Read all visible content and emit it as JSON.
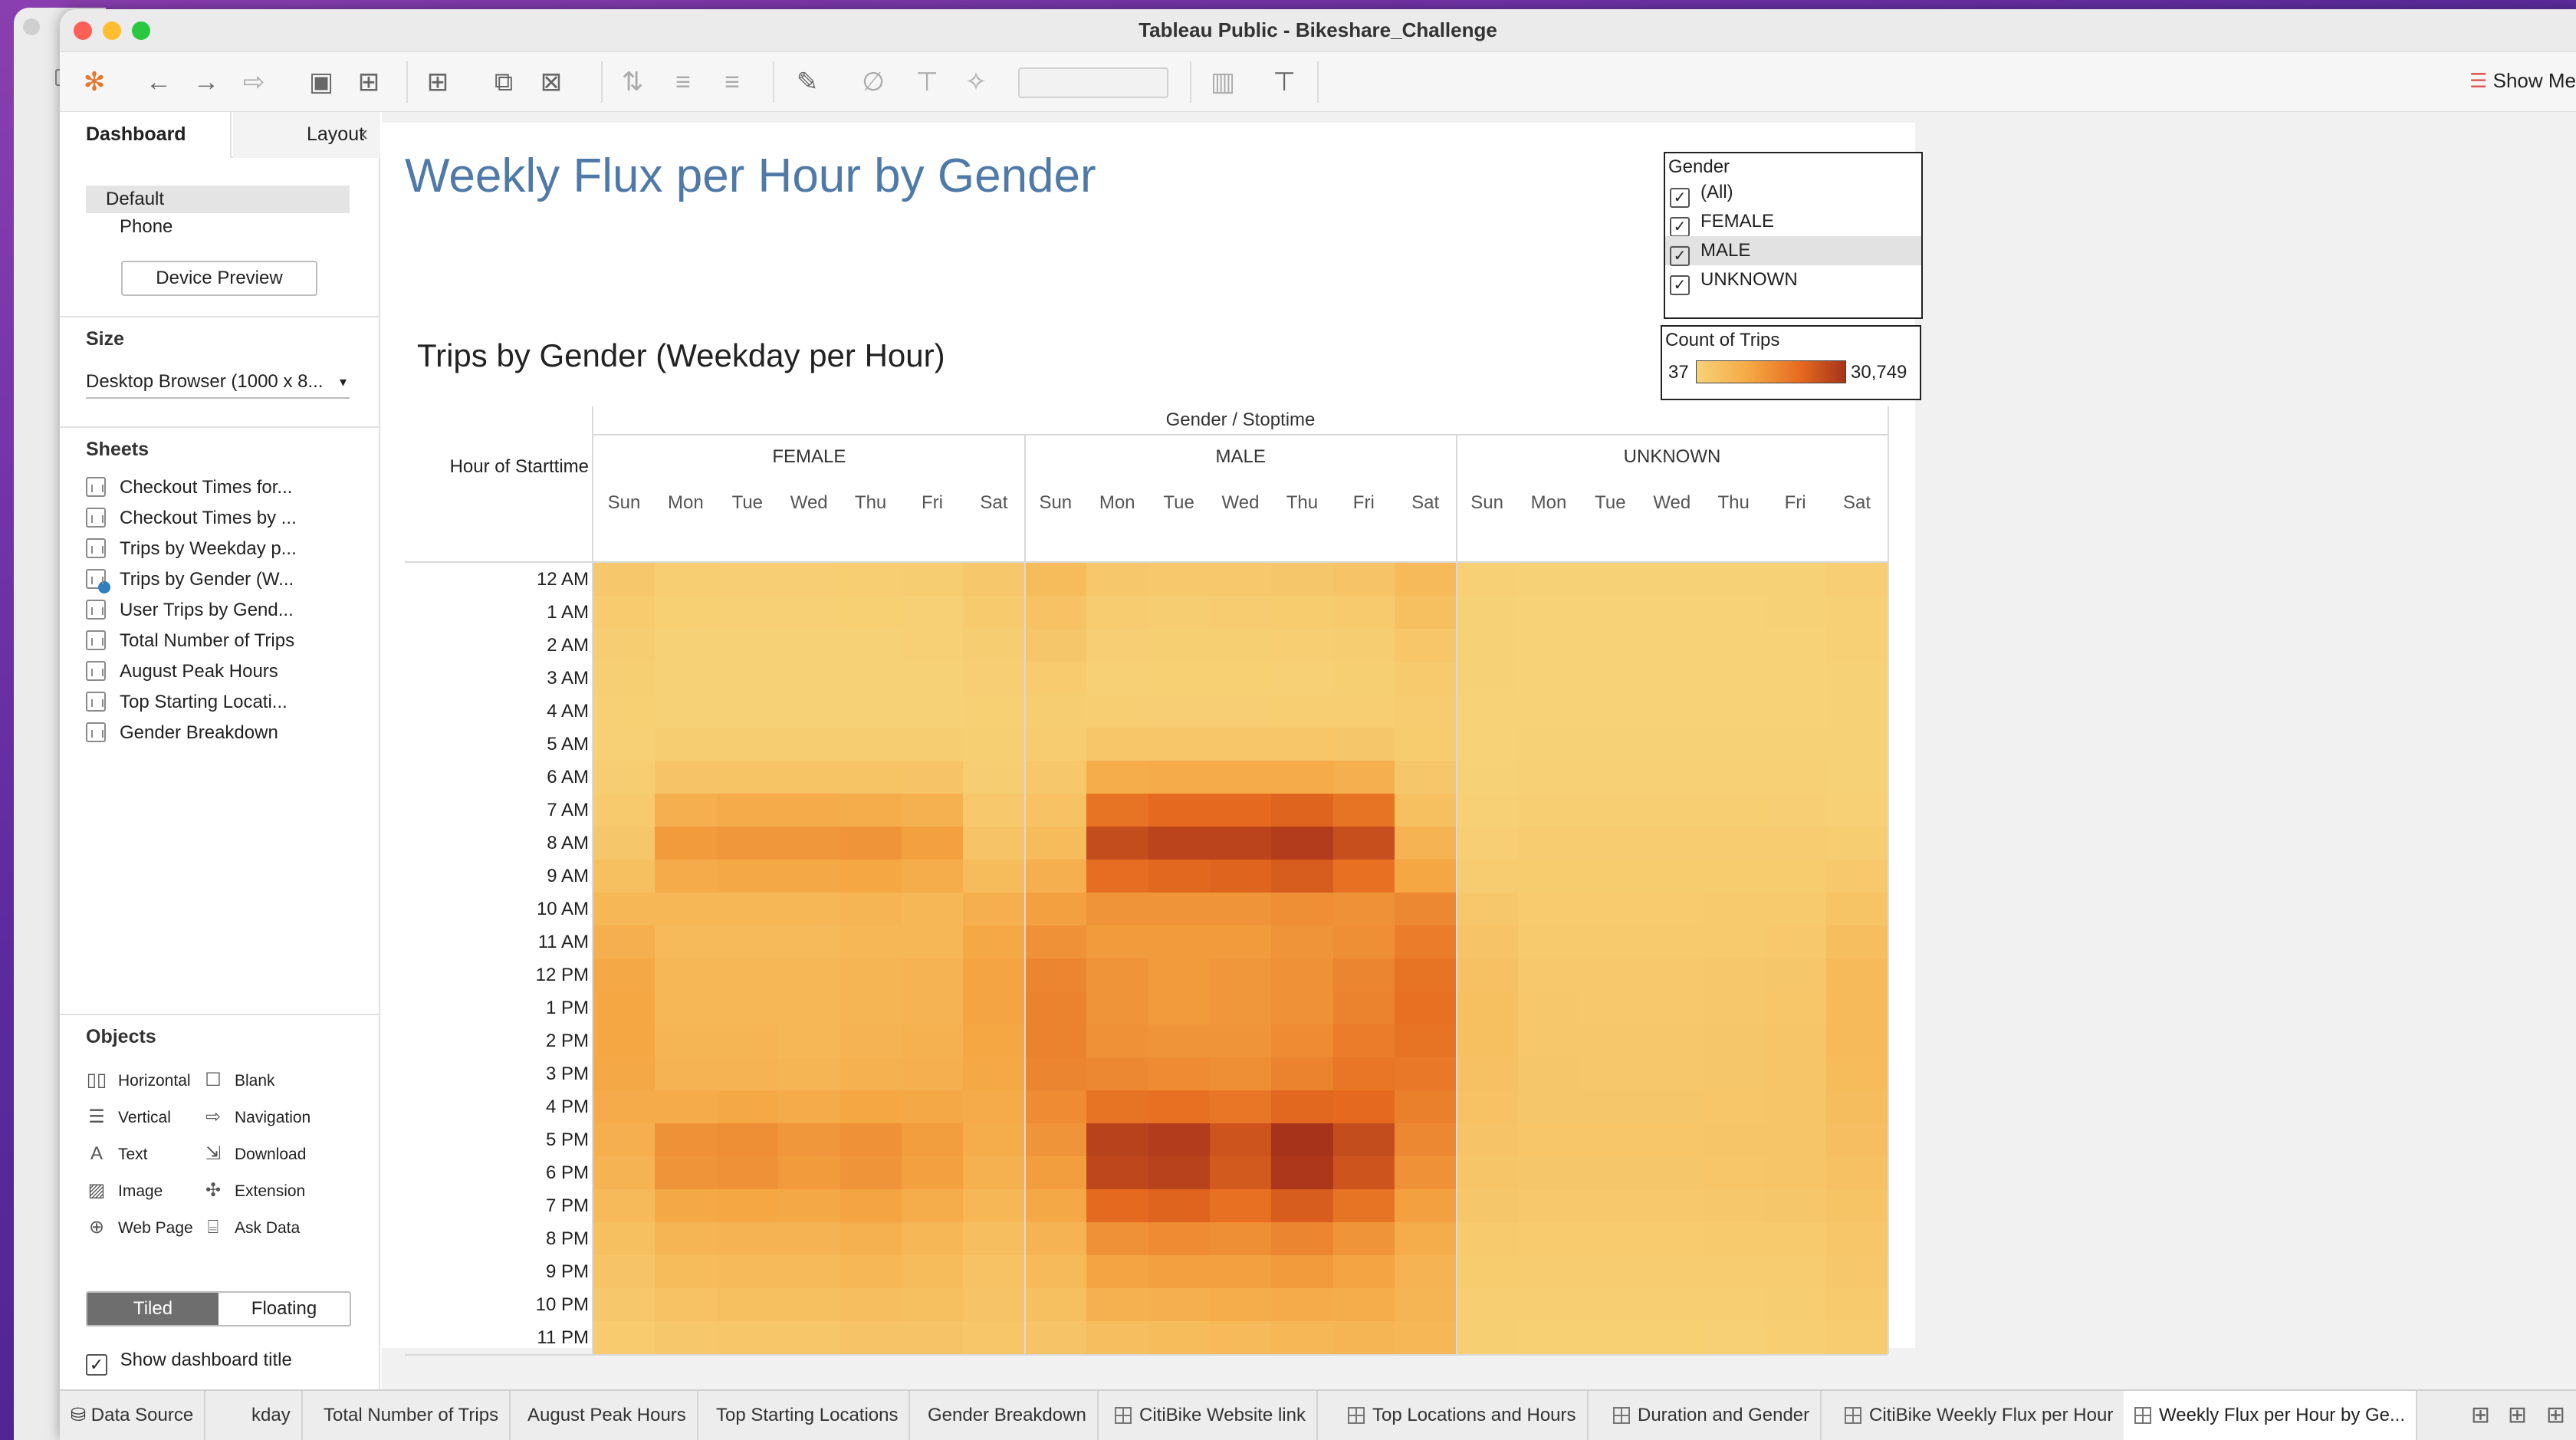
{
  "window": {
    "title": "Tableau Public - Bikeshare_Challenge"
  },
  "toolbar": {
    "show_me": "Show Me"
  },
  "left_pane": {
    "tabs": {
      "dashboard": "Dashboard",
      "layout": "Layout"
    },
    "devices": [
      "Default",
      "Phone"
    ],
    "device_preview": "Device Preview",
    "size_title": "Size",
    "size_value": "Desktop Browser (1000 x 8...",
    "sheets_title": "Sheets",
    "sheets": [
      "Checkout Times for...",
      "Checkout Times by ...",
      "Trips by Weekday p...",
      "Trips by Gender (W...",
      "User Trips by Gend...",
      "Total Number of Trips",
      "August Peak Hours",
      "Top Starting Locati...",
      "Gender Breakdown"
    ],
    "objects_title": "Objects",
    "objects": [
      {
        "label": "Horizontal",
        "icon": "horizontal-icon",
        "glyph": "▯▯"
      },
      {
        "label": "Blank",
        "icon": "blank-icon",
        "glyph": "☐"
      },
      {
        "label": "Vertical",
        "icon": "vertical-icon",
        "glyph": "☰"
      },
      {
        "label": "Navigation",
        "icon": "navigation-icon",
        "glyph": "⇨"
      },
      {
        "label": "Text",
        "icon": "text-icon",
        "glyph": "A"
      },
      {
        "label": "Download",
        "icon": "download-icon",
        "glyph": "⇲"
      },
      {
        "label": "Image",
        "icon": "image-icon",
        "glyph": "▨"
      },
      {
        "label": "Extension",
        "icon": "extension-icon",
        "glyph": "✣"
      },
      {
        "label": "Web Page",
        "icon": "web-page-icon",
        "glyph": "⊕"
      },
      {
        "label": "Ask Data",
        "icon": "ask-data-icon",
        "glyph": "⌸"
      }
    ],
    "tiled": "Tiled",
    "floating": "Floating",
    "show_title": "Show dashboard title"
  },
  "dashboard": {
    "title": "Weekly Flux per Hour by Gender",
    "chart_title": "Trips by Gender (Weekday per Hour)",
    "gender_filter": {
      "title": "Gender",
      "options": [
        "(All)",
        "FEMALE",
        "MALE",
        "UNKNOWN"
      ],
      "highlighted": "MALE"
    },
    "color_legend": {
      "title": "Count of Trips",
      "min": "37",
      "max": "30,749",
      "colors": [
        "#f7d277",
        "#f5a845",
        "#e56a1f",
        "#a7331b"
      ]
    }
  },
  "chart_data": {
    "type": "heatmap",
    "title": "Trips by Gender (Weekday per Hour)",
    "column_header": "Gender / Stoptime",
    "row_header": "Hour of Starttime",
    "groups": [
      "FEMALE",
      "MALE",
      "UNKNOWN"
    ],
    "days": [
      "Sun",
      "Mon",
      "Tue",
      "Wed",
      "Thu",
      "Fri",
      "Sat"
    ],
    "hours": [
      "12 AM",
      "1 AM",
      "2 AM",
      "3 AM",
      "4 AM",
      "5 AM",
      "6 AM",
      "7 AM",
      "8 AM",
      "9 AM",
      "10 AM",
      "11 AM",
      "12 PM",
      "1 PM",
      "2 PM",
      "3 PM",
      "4 PM",
      "5 PM",
      "6 PM",
      "7 PM",
      "8 PM",
      "9 PM",
      "10 PM",
      "11 PM"
    ],
    "color_range": [
      37,
      30749
    ],
    "values": {
      "FEMALE": [
        [
          2500,
          1000,
          900,
          900,
          1000,
          1200,
          2500
        ],
        [
          1800,
          600,
          500,
          500,
          600,
          700,
          1900
        ],
        [
          1200,
          400,
          300,
          300,
          400,
          500,
          1300
        ],
        [
          800,
          300,
          200,
          200,
          300,
          300,
          900
        ],
        [
          600,
          400,
          300,
          300,
          400,
          400,
          600
        ],
        [
          700,
          1200,
          1200,
          1200,
          1200,
          1200,
          800
        ],
        [
          1200,
          3500,
          3800,
          3800,
          3800,
          3500,
          1300
        ],
        [
          2000,
          8500,
          9500,
          9500,
          9000,
          8000,
          2300
        ],
        [
          2800,
          12500,
          13000,
          13000,
          13500,
          11500,
          3500
        ],
        [
          4500,
          9500,
          10000,
          10000,
          10500,
          9000,
          5500
        ],
        [
          6500,
          6500,
          6500,
          6500,
          7000,
          6500,
          8500
        ],
        [
          8500,
          6000,
          6000,
          6000,
          6500,
          6500,
          10000
        ],
        [
          10000,
          6500,
          6500,
          6500,
          7000,
          7500,
          11000
        ],
        [
          10500,
          6500,
          6500,
          6500,
          7000,
          7500,
          11000
        ],
        [
          10500,
          7000,
          7000,
          6500,
          7500,
          8000,
          10500
        ],
        [
          10000,
          7500,
          7500,
          7000,
          8000,
          8500,
          10000
        ],
        [
          9500,
          9500,
          10000,
          9500,
          10500,
          10000,
          9500
        ],
        [
          8500,
          14000,
          14500,
          13000,
          14000,
          12000,
          9000
        ],
        [
          7500,
          13500,
          14000,
          12500,
          13500,
          11500,
          8000
        ],
        [
          6000,
          10000,
          10500,
          10000,
          11000,
          9000,
          6500
        ],
        [
          4500,
          7000,
          7500,
          7500,
          8000,
          6500,
          5000
        ],
        [
          3500,
          5500,
          6000,
          6000,
          6500,
          5500,
          4000
        ],
        [
          2500,
          4000,
          4500,
          4500,
          5000,
          4500,
          3500
        ],
        [
          1800,
          2500,
          3000,
          3000,
          3500,
          3500,
          3000
        ]
      ],
      "MALE": [
        [
          5500,
          2500,
          2200,
          2300,
          2600,
          3500,
          6000
        ],
        [
          4000,
          1500,
          1300,
          1400,
          1600,
          2000,
          4500
        ],
        [
          2800,
          900,
          800,
          800,
          1000,
          1200,
          3000
        ],
        [
          1800,
          700,
          600,
          600,
          700,
          800,
          2000
        ],
        [
          1300,
          1000,
          900,
          900,
          1000,
          1000,
          1400
        ],
        [
          1400,
          3000,
          3000,
          3000,
          3000,
          2800,
          1600
        ],
        [
          2500,
          9000,
          9500,
          9500,
          9500,
          8500,
          2800
        ],
        [
          4000,
          19000,
          20500,
          20500,
          21500,
          19000,
          4500
        ],
        [
          5500,
          26000,
          27500,
          27500,
          29000,
          25500,
          7500
        ],
        [
          8500,
          20000,
          21000,
          21500,
          23000,
          19500,
          10500
        ],
        [
          11500,
          13500,
          13500,
          13500,
          14500,
          14000,
          15500
        ],
        [
          14000,
          12500,
          12500,
          12500,
          13500,
          14500,
          17500
        ],
        [
          16000,
          13500,
          12500,
          13000,
          14000,
          16000,
          19000
        ],
        [
          16500,
          13500,
          12500,
          13000,
          14000,
          16500,
          19500
        ],
        [
          16500,
          14000,
          13500,
          13500,
          15000,
          17500,
          19000
        ],
        [
          16000,
          15500,
          15000,
          14500,
          16500,
          18500,
          18000
        ],
        [
          15000,
          19000,
          19500,
          18500,
          21000,
          20500,
          17000
        ],
        [
          13500,
          28000,
          29000,
          24500,
          30749,
          26000,
          15500
        ],
        [
          12000,
          27000,
          28000,
          23500,
          30000,
          24500,
          14000
        ],
        [
          10000,
          20500,
          21500,
          19500,
          23000,
          19000,
          11500
        ],
        [
          7500,
          14000,
          15000,
          14500,
          16000,
          13500,
          9000
        ],
        [
          6000,
          11000,
          11500,
          11500,
          12500,
          11000,
          7500
        ],
        [
          4500,
          8000,
          8500,
          9000,
          9500,
          9000,
          7000
        ],
        [
          3500,
          5000,
          5500,
          6000,
          6500,
          7000,
          6500
        ]
      ],
      "UNKNOWN": [
        [
          500,
          200,
          200,
          200,
          200,
          300,
          900
        ],
        [
          400,
          150,
          120,
          120,
          150,
          200,
          700
        ],
        [
          300,
          100,
          80,
          80,
          100,
          150,
          500
        ],
        [
          200,
          80,
          60,
          60,
          80,
          100,
          350
        ],
        [
          150,
          80,
          60,
          60,
          80,
          80,
          250
        ],
        [
          150,
          200,
          200,
          200,
          200,
          200,
          200
        ],
        [
          250,
          500,
          500,
          500,
          500,
          500,
          350
        ],
        [
          500,
          1000,
          1000,
          1000,
          1000,
          900,
          700
        ],
        [
          900,
          1500,
          1500,
          1500,
          1500,
          1400,
          1200
        ],
        [
          1500,
          1600,
          1600,
          1600,
          1600,
          1600,
          2200
        ],
        [
          2500,
          1800,
          1800,
          1800,
          1900,
          2000,
          3800
        ],
        [
          3500,
          2000,
          2000,
          2000,
          2100,
          2300,
          5000
        ],
        [
          4200,
          2300,
          2200,
          2200,
          2400,
          2800,
          5800
        ],
        [
          4500,
          2400,
          2300,
          2300,
          2500,
          3000,
          6000
        ],
        [
          4500,
          2500,
          2400,
          2400,
          2600,
          3200,
          5800
        ],
        [
          4300,
          2600,
          2500,
          2500,
          2700,
          3300,
          5500
        ],
        [
          4000,
          2800,
          2700,
          2700,
          2900,
          3300,
          5200
        ],
        [
          3600,
          3000,
          3000,
          2900,
          3100,
          3300,
          4800
        ],
        [
          3200,
          2800,
          2800,
          2700,
          2900,
          3100,
          4300
        ],
        [
          2700,
          2300,
          2300,
          2300,
          2400,
          2600,
          3700
        ],
        [
          2100,
          1800,
          1800,
          1800,
          1900,
          2100,
          3000
        ],
        [
          1600,
          1400,
          1400,
          1400,
          1500,
          1700,
          2400
        ],
        [
          1100,
          1000,
          1000,
          1000,
          1100,
          1300,
          1900
        ],
        [
          800,
          600,
          600,
          600,
          700,
          1000,
          1500
        ]
      ]
    }
  },
  "bottom_tabs": [
    {
      "label": "Data Source",
      "icon": "database-icon"
    },
    {
      "label": "kday",
      "icon": ""
    },
    {
      "label": "Total Number of Trips",
      "icon": ""
    },
    {
      "label": "August Peak Hours",
      "icon": ""
    },
    {
      "label": "Top Starting Locations",
      "icon": ""
    },
    {
      "label": "Gender Breakdown",
      "icon": ""
    },
    {
      "label": "CitiBike Website link",
      "icon": "dashboard-icon"
    },
    {
      "label": "Top Locations and Hours",
      "icon": "dashboard-icon"
    },
    {
      "label": "Duration and Gender",
      "icon": "dashboard-icon"
    },
    {
      "label": "CitiBike Weekly Flux per Hour",
      "icon": "dashboard-icon"
    },
    {
      "label": "Weekly Flux per Hour by Ge...",
      "icon": "dashboard-icon"
    }
  ]
}
